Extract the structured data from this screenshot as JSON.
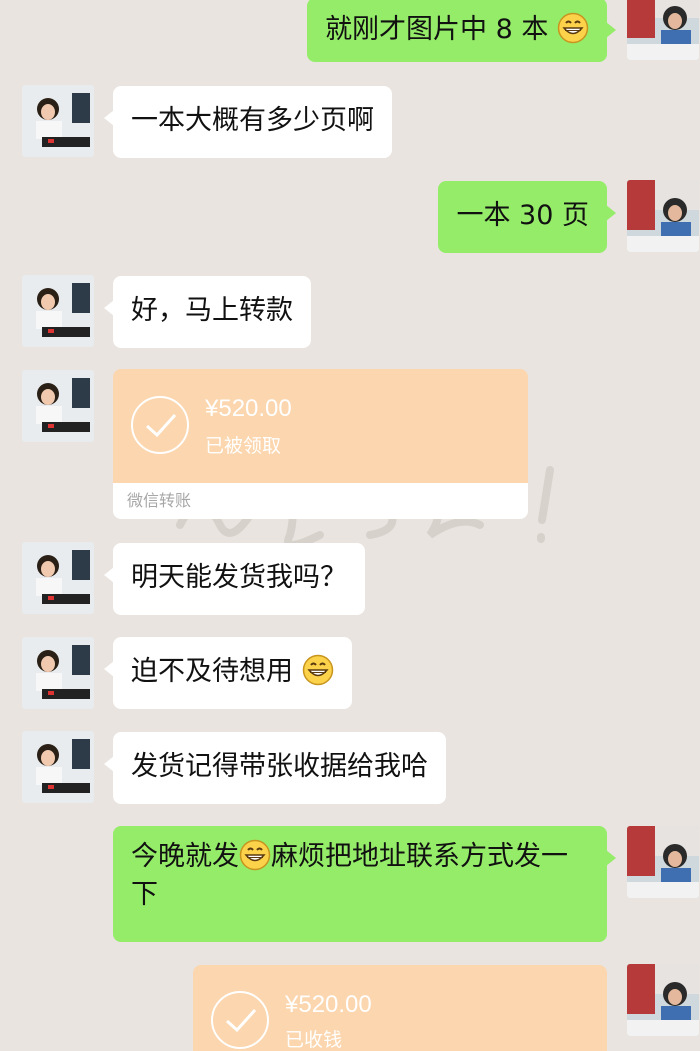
{
  "messages": {
    "m1": {
      "text": "就刚才图片中 8 本"
    },
    "m2": {
      "text": "一本大概有多少页啊"
    },
    "m3": {
      "text": "一本 30 页"
    },
    "m4": {
      "text": "好，马上转款"
    },
    "m5": {
      "amount": "¥520.00",
      "status": "已被领取",
      "footer": "微信转账"
    },
    "m6": {
      "text": "明天能发货我吗？"
    },
    "m7": {
      "text": "迫不及待想用"
    },
    "m8": {
      "text": "发货记得带张收据给我哈"
    },
    "m9": {
      "text_a": "今晚就发",
      "text_b": "麻烦把地址联系方式发一下"
    },
    "m10": {
      "amount": "¥520.00",
      "status": "已收钱"
    }
  },
  "icons": {
    "emoji": "grinning-face-emoji",
    "transfer_done": "check-circle-icon"
  },
  "colors": {
    "background": "#e9e4df",
    "bubble_out": "#95ec69",
    "bubble_in": "#ffffff",
    "transfer": "#fbd6ae"
  }
}
